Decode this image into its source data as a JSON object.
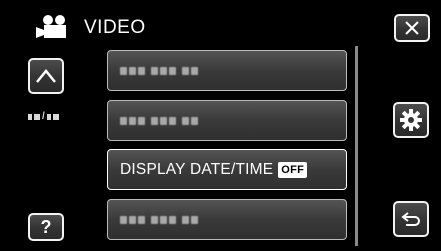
{
  "header": {
    "title": "VIDEO",
    "mode_icon": "video-camera-icon"
  },
  "controls": {
    "close_icon": "close-icon",
    "up_icon": "chevron-up-icon",
    "help_label": "?",
    "settings_icon": "gear-icon",
    "back_icon": "return-icon"
  },
  "page_indicator": {
    "icon": "page-indicator-icon"
  },
  "menu": {
    "items": [
      {
        "label": "",
        "value": ""
      },
      {
        "label": "",
        "value": ""
      },
      {
        "label": "DISPLAY DATE/TIME",
        "value": "OFF"
      },
      {
        "label": "",
        "value": ""
      }
    ]
  },
  "colors": {
    "background": "#000000",
    "button_border": "#f2f2f2",
    "text": "#ffffff"
  }
}
